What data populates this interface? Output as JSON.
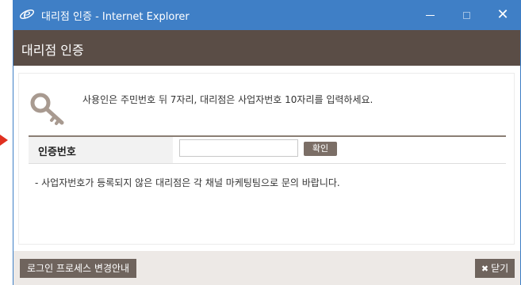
{
  "window": {
    "title": "대리점 인증 - Internet Explorer",
    "icons": {
      "app": "internet-explorer-icon",
      "minimize": "minimize-icon",
      "maximize": "maximize-icon",
      "close": "close-icon"
    },
    "close_glyph": "✕"
  },
  "dialog": {
    "title": "대리점 인증",
    "instruction": "사용인은 주민번호 뒤 7자리, 대리점은 사업자번호 10자리를 입력하세요.",
    "key_icon": "key-icon",
    "auth": {
      "label": "인증번호",
      "input_value": "",
      "input_placeholder": "",
      "confirm_label": "확인"
    },
    "notice": "- 사업자번호가 등록되지 않은 대리점은 각 채널 마케팅팀으로 문의 바랍니다."
  },
  "footer": {
    "process_button_label": "로그인 프로세스 변경안내",
    "close_button_label": "닫기",
    "close_button_icon": "x-icon",
    "close_button_glyph": "✖"
  },
  "colors": {
    "titlebar": "#3f7fc6",
    "header_bar": "#5a4d46",
    "button": "#6f645d",
    "confirm_button": "#7b6e66",
    "footer_bar": "#ede9e6",
    "arrow": "#e03020"
  }
}
